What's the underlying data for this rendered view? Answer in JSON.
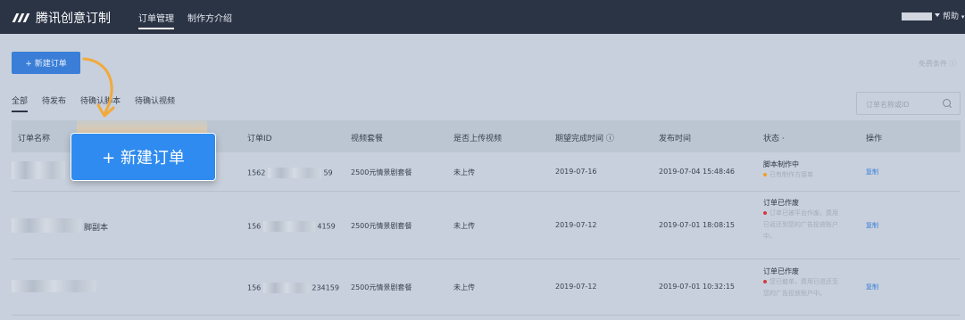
{
  "header": {
    "brand": "腾讯创意订制",
    "nav": [
      "订单管理",
      "制作方介绍"
    ],
    "help": "帮助"
  },
  "toolbar": {
    "new_order": "+ 新建订单",
    "free_tip": "免费条件 ⓘ"
  },
  "tabs": [
    "全部",
    "待发布",
    "待确认脚本",
    "待确认视频"
  ],
  "search": {
    "placeholder": "订单名称或ID"
  },
  "table": {
    "headers": [
      "订单名称",
      "订单ID",
      "视频套餐",
      "是否上传视频",
      "期望完成时间 ⓘ",
      "发布时间",
      "状态 ·",
      "操作"
    ],
    "rows": [
      {
        "name": "",
        "id_prefix": "1562",
        "id_suffix": "59",
        "package": "2500元情景剧套餐",
        "uploaded": "未上传",
        "expected": "2019-07-16",
        "published": "2019-07-04 15:48:46",
        "status": "脚本制作中",
        "status_lines": [
          "已有制作方接单"
        ],
        "status_color": "#f0a020",
        "action": "复制"
      },
      {
        "name": "脚副本",
        "id_prefix": "156",
        "id_suffix": "4159",
        "package": "2500元情景剧套餐",
        "uploaded": "未上传",
        "expected": "2019-07-12",
        "published": "2019-07-01 18:08:15",
        "status": "订单已作废",
        "status_lines": [
          "订单已被平台作废，费用",
          "已返还到您的广告投放账户",
          "中。"
        ],
        "status_color": "#d83a3a",
        "action": "复制"
      },
      {
        "name": "",
        "id_prefix": "156",
        "id_suffix": "234159",
        "package": "2500元情景剧套餐",
        "uploaded": "未上传",
        "expected": "2019-07-12",
        "published": "2019-07-01 10:32:15",
        "status": "订单已作废",
        "status_lines": [
          "您已撤单，费用已退还至",
          "您的广告投放账户中。"
        ],
        "status_color": "#d83a3a",
        "action": "复制"
      }
    ]
  },
  "callout": {
    "label": "+ 新建订单"
  },
  "colors": {
    "accent": "#3a7ed8",
    "callout": "#2f8bef",
    "arrow": "#f2a93b",
    "topbar": "#2b3445"
  }
}
